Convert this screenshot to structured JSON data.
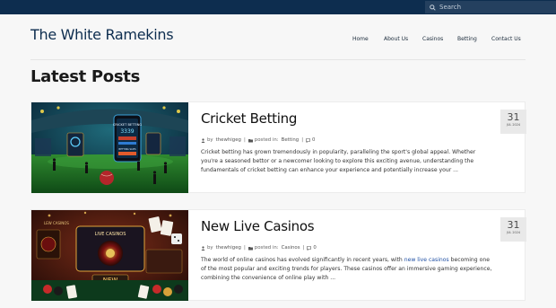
{
  "search": {
    "placeholder": "Search"
  },
  "site": {
    "title": "The White Ramekins"
  },
  "nav": {
    "items": [
      "Home",
      "About Us",
      "Casinos",
      "Betting",
      "Contact Us"
    ]
  },
  "page_heading": "Latest Posts",
  "posts": [
    {
      "title": "Cricket Betting",
      "author_prefix": "by",
      "author": "thewhigeg",
      "sep": "|",
      "posted_in": "posted in:",
      "category": "Betting",
      "comments": "0",
      "excerpt": "Cricket betting has grown tremendously in popularity, paralleling the sport's global appeal. Whether you're a seasoned bettor or a newcomer looking to explore this exciting avenue, understanding the fundamentals of cricket betting can enhance your experience and potentially increase your ...",
      "day": "31",
      "month_year": "JUL 2024",
      "image_text": [
        "CRICKET BETTING",
        "3339",
        "BETTING SLIPS"
      ]
    },
    {
      "title": "New Live Casinos",
      "author_prefix": "by",
      "author": "thewhigeg",
      "sep": "|",
      "posted_in": "posted in:",
      "category": "Casinos",
      "comments": "0",
      "excerpt_before": "The world of online casinos has evolved significantly in recent years, with ",
      "excerpt_link": "new live casinos",
      "excerpt_after": " becoming one of the most popular and exciting trends for players. These casinos offer an immersive gaming experience, combining the convenience of online play with ...",
      "day": "31",
      "month_year": "JUL 2024",
      "image_text": [
        "LIVE CASINOS",
        "NEW",
        "LEW CASINOS"
      ]
    }
  ],
  "colors": {
    "topbar": "#0d2d4f",
    "title": "#0d2d4f",
    "link": "#1f4fa3"
  },
  "icons": [
    "search-icon",
    "user-icon",
    "folder-icon",
    "comment-icon"
  ]
}
